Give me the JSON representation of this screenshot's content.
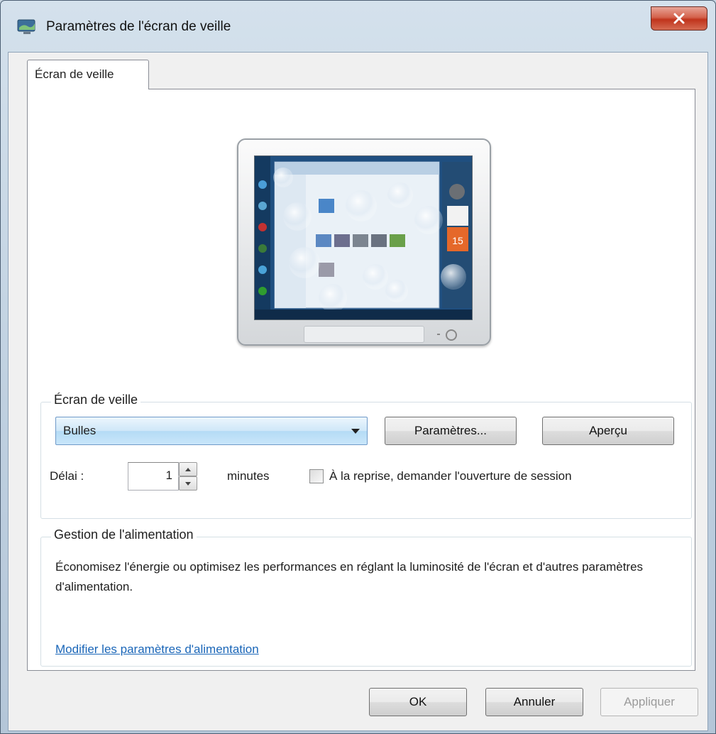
{
  "window": {
    "title": "Paramètres de l'écran de veille"
  },
  "tabs": [
    {
      "label": "Écran de veille"
    }
  ],
  "preview": {
    "calendar_day": "15"
  },
  "screensaver": {
    "legend": "Écran de veille",
    "selected": "Bulles",
    "settings_button": "Paramètres...",
    "preview_button": "Aperçu",
    "delay_label": "Délai :",
    "delay_value": "1",
    "minutes_label": "minutes",
    "resume_checkbox_label": "À la reprise, demander l'ouverture de session",
    "resume_checked": false
  },
  "power": {
    "legend": "Gestion de l'alimentation",
    "description": "Économisez l'énergie ou optimisez les performances en réglant la luminosité de l'écran et d'autres paramètres d'alimentation.",
    "link": "Modifier les paramètres d'alimentation"
  },
  "footer": {
    "ok": "OK",
    "cancel": "Annuler",
    "apply": "Appliquer"
  },
  "colors": {
    "link": "#1a66b8",
    "close_button": "#c0341c",
    "combo_highlight": "#b4dbf5"
  }
}
